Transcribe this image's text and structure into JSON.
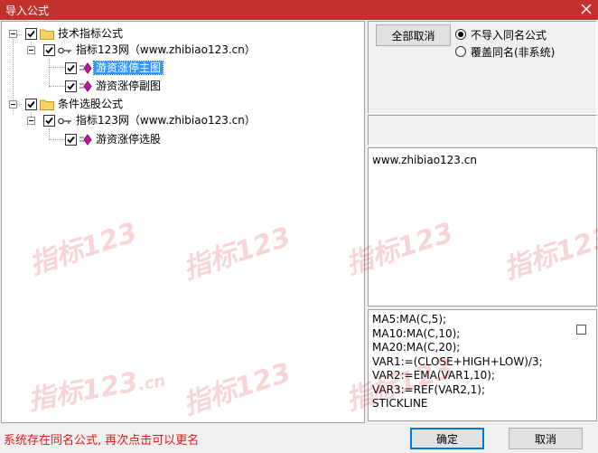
{
  "window": {
    "title": "导入公式"
  },
  "tree": {
    "items": [
      {
        "label": "技术指标公式"
      },
      {
        "label": "指标123网（www.zhibiao123.cn）"
      },
      {
        "label": "游资涨停主图"
      },
      {
        "label": "游资涨停副图"
      },
      {
        "label": "条件选股公式"
      },
      {
        "label": "指标123网（www.zhibiao123.cn）"
      },
      {
        "label": "游资涨停选股"
      }
    ]
  },
  "options": {
    "select_all_label": "全部取消",
    "radio_no_import": "不导入同名公式",
    "radio_overwrite": "覆盖同名(非系统)",
    "selected": "不导入同名公式"
  },
  "description": {
    "text": "www.zhibiao123.cn"
  },
  "code": {
    "lines": [
      "MA5:MA(C,5);",
      "MA10:MA(C,10);",
      "MA20:MA(C,20);",
      "VAR1:=(CLOSE+HIGH+LOW)/3;",
      "VAR2:=EMA(VAR1,10);",
      "VAR3:=REF(VAR2,1);",
      "STICKLINE"
    ]
  },
  "status": {
    "message": "系统存在同名公式, 再次点击可以更名"
  },
  "footer": {
    "ok_label": "确定",
    "cancel_label": "取消"
  },
  "watermark": {
    "text": "指标123",
    "suffix": ".cn"
  },
  "colors": {
    "title_bar": "#c3312e",
    "status_text": "#e0161c",
    "selection": "#3399ff"
  }
}
